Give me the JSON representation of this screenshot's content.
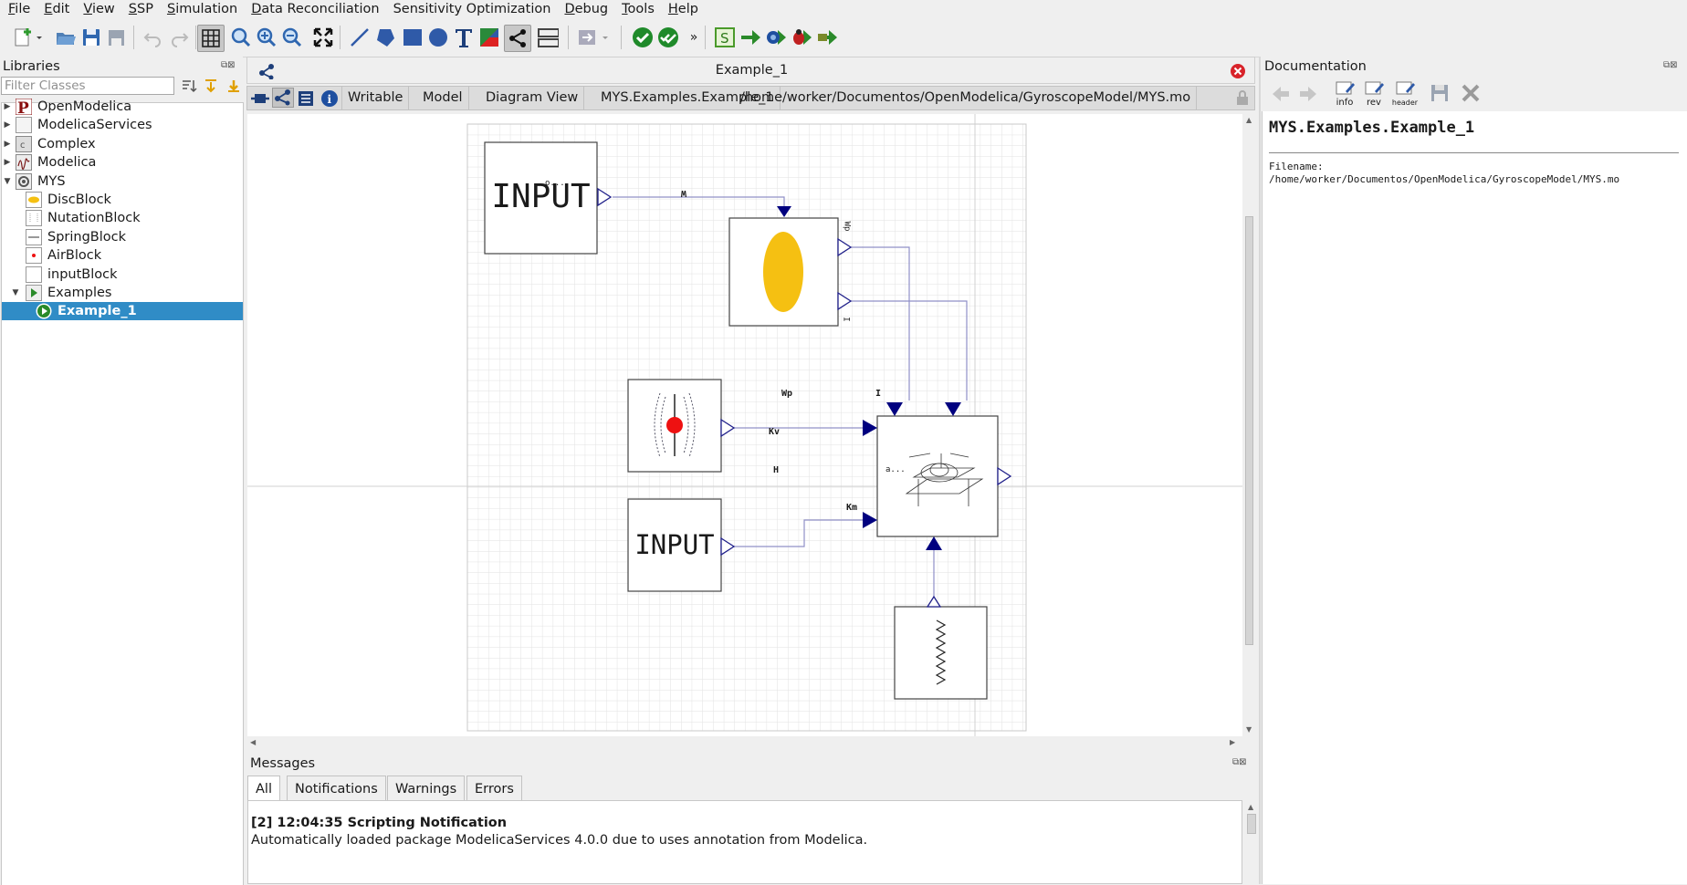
{
  "menu": [
    {
      "label": "File",
      "u": "F",
      "rest": "ile"
    },
    {
      "label": "Edit",
      "u": "E",
      "rest": "dit"
    },
    {
      "label": "View",
      "u": "V",
      "rest": "iew"
    },
    {
      "label": "SSP",
      "u": "S",
      "rest": "SP"
    },
    {
      "label": "Simulation",
      "u": "S",
      "rest": "imulation"
    },
    {
      "label": "Data Reconciliation",
      "u": "D",
      "rest": "ata Reconciliation"
    },
    {
      "label": "Sensitivity Optimization",
      "u": "",
      "rest": "Sensitivity Optimization"
    },
    {
      "label": "Debug",
      "u": "D",
      "rest": "ebug"
    },
    {
      "label": "Tools",
      "u": "T",
      "rest": "ools"
    },
    {
      "label": "Help",
      "u": "H",
      "rest": "elp"
    }
  ],
  "libraries": {
    "title": "Libraries",
    "filter_placeholder": "Filter Classes",
    "items": [
      {
        "label": "OpenModelica",
        "depth": 0,
        "arrow": "right",
        "icon": "openmodelica-icon"
      },
      {
        "label": "ModelicaServices",
        "depth": 0,
        "arrow": "right",
        "icon": "package-icon"
      },
      {
        "label": "Complex",
        "depth": 0,
        "arrow": "right",
        "icon": "complex-icon"
      },
      {
        "label": "Modelica",
        "depth": 0,
        "arrow": "right",
        "icon": "modelica-icon"
      },
      {
        "label": "MYS",
        "depth": 0,
        "arrow": "down",
        "icon": "mys-icon"
      },
      {
        "label": "DiscBlock",
        "depth": 1,
        "arrow": "",
        "icon": "disc-block-icon"
      },
      {
        "label": "NutationBlock",
        "depth": 1,
        "arrow": "",
        "icon": "nutation-block-icon"
      },
      {
        "label": "SpringBlock",
        "depth": 1,
        "arrow": "",
        "icon": "spring-block-icon"
      },
      {
        "label": "AirBlock",
        "depth": 1,
        "arrow": "",
        "icon": "air-block-icon"
      },
      {
        "label": "inputBlock",
        "depth": 1,
        "arrow": "",
        "icon": "input-block-icon"
      },
      {
        "label": "Examples",
        "depth": 1,
        "arrow": "down",
        "icon": "examples-icon"
      },
      {
        "label": "Example_1",
        "depth": 2,
        "arrow": "",
        "icon": "example-icon",
        "selected": true
      }
    ]
  },
  "model": {
    "title": "Example_1",
    "tabs": [
      "Writable",
      "Model",
      "Diagram View",
      "MYS.Examples.Example_1",
      "/home/worker/Documentos/OpenModelica/GyroscopeModel/MYS.mo"
    ],
    "blocks": {
      "input1": "INPUT",
      "input2": "INPUT",
      "input1_port": "o...",
      "disc_w": "W",
      "disc_wp": "Wp",
      "disc_i": "I",
      "gyro_wp": "Wp",
      "gyro_i": "I",
      "gyro_kv": "Kv",
      "gyro_h": "H",
      "gyro_km": "Km",
      "gyro_out": "a..."
    }
  },
  "messages": {
    "title": "Messages",
    "tabs": [
      "All",
      "Notifications",
      "Warnings",
      "Errors"
    ],
    "active_tab": "All",
    "entry_header": "[2] 12:04:35 Scripting Notification",
    "entry_text": "Automatically loaded package ModelicaServices 4.0.0 due to uses annotation from Modelica."
  },
  "documentation": {
    "title": "Documentation",
    "heading": "MYS.Examples.Example_1",
    "filename_label": "Filename:",
    "filename": "/home/worker/Documentos/OpenModelica/GyroscopeModel/MYS.mo",
    "buttons": [
      "info",
      "rev",
      "header"
    ]
  },
  "colors": {
    "selection": "#308cc6",
    "connector": "#00007f",
    "disc": "#f5c012",
    "close_red": "#d8232a"
  }
}
